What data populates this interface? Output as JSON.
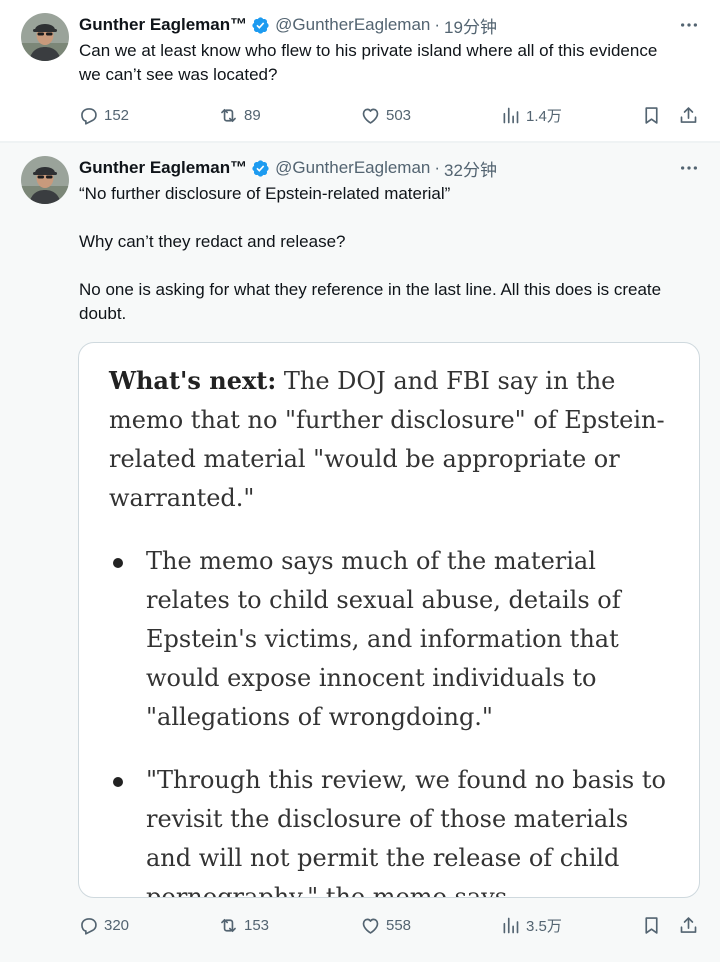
{
  "tweets": [
    {
      "name": "Gunther Eagleman™",
      "handle": "@GuntherEagleman",
      "dot": "·",
      "time": "19分钟",
      "paragraphs": [
        "Can we at least know who flew to his private island where all of this evidence we can’t see was located?"
      ],
      "stats": {
        "replies": "152",
        "reposts": "89",
        "likes": "503",
        "views": "1.4万"
      }
    },
    {
      "name": "Gunther Eagleman™",
      "handle": "@GuntherEagleman",
      "dot": "·",
      "time": "32分钟",
      "paragraphs": [
        "“No further disclosure of Epstein-related material”",
        "Why can’t they redact and release?",
        "No one is asking for what they reference in the last line. All this does is create doubt."
      ],
      "media": {
        "lead_bold": "What's next:",
        "lead_text": " The DOJ and FBI say in the memo that no \"further disclosure\" of Epstein-related material \"would be appropriate or warranted.\"",
        "bullets": [
          "The memo says much of the material relates to child sexual abuse, details of Epstein's victims, and information that would expose innocent individuals to \"allegations of wrongdoing.\"",
          "\"Through this review, we found no basis to revisit the disclosure of those materials and will not permit the release of child pornography,\" the memo says."
        ]
      },
      "stats": {
        "replies": "320",
        "reposts": "153",
        "likes": "558",
        "views": "3.5万"
      }
    }
  ],
  "colors": {
    "verified": "#1d9bf0",
    "muted_text": "#536471",
    "primary_text": "#0f1419",
    "selected_background": "#f7f9f9"
  },
  "icons": [
    "verified-badge-icon",
    "more-icon",
    "reply-icon",
    "repost-icon",
    "like-icon",
    "views-icon",
    "bookmark-icon",
    "share-icon"
  ]
}
